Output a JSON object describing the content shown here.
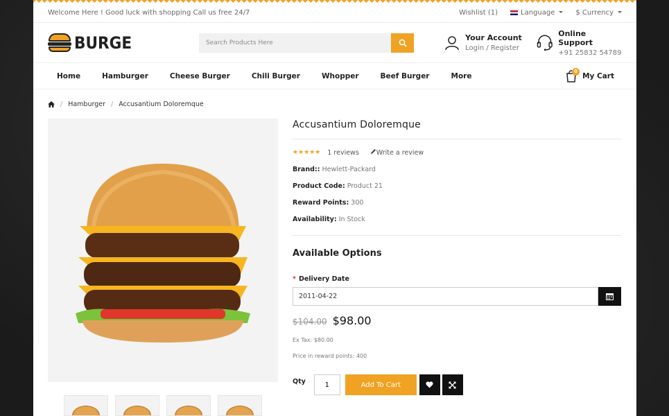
{
  "topbar": {
    "welcome": "Welcome Here ! Good luck with shopping Call us free 24/7",
    "wishlist": "Wishlist (1)",
    "language": "Language",
    "currency": "$ Currency"
  },
  "header": {
    "logo": "BURGE",
    "search_placeholder": "Search Products Here",
    "account_title": "Your Account",
    "account_sub": "Login / Register",
    "support_title": "Online Support",
    "support_phone": "+91 25832 54789"
  },
  "nav": {
    "items": [
      "Home",
      "Hamburger",
      "Cheese Burger",
      "Chili Burger",
      "Whopper",
      "Beef Burger",
      "More"
    ],
    "cart_label": "My Cart",
    "cart_count": "0"
  },
  "breadcrumb": [
    "Hamburger",
    "Accusantium Doloremque"
  ],
  "product": {
    "title": "Accusantium Doloremque",
    "reviews": "1 reviews",
    "write_review": "Write a review",
    "brand_label": "Brand::",
    "brand": "Hewlett-Packard",
    "code_label": "Product Code:",
    "code": "Product 21",
    "points_label": "Reward Points:",
    "points": "300",
    "availability_label": "Availability:",
    "availability": "In Stock",
    "rating": 5
  },
  "options": {
    "title": "Available Options",
    "delivery_label": "Delivery Date",
    "delivery_value": "2011-04-22"
  },
  "pricing": {
    "old_price": "$104.00",
    "new_price": "$98.00",
    "ex_tax": "Ex Tax: $80.00",
    "reward_price": "Price in reward points: 400"
  },
  "purchase": {
    "qty_label": "Qty",
    "qty_value": "1",
    "add_to_cart": "Add To Cart"
  },
  "colors": {
    "accent": "#f0a223",
    "dark": "#111111"
  }
}
